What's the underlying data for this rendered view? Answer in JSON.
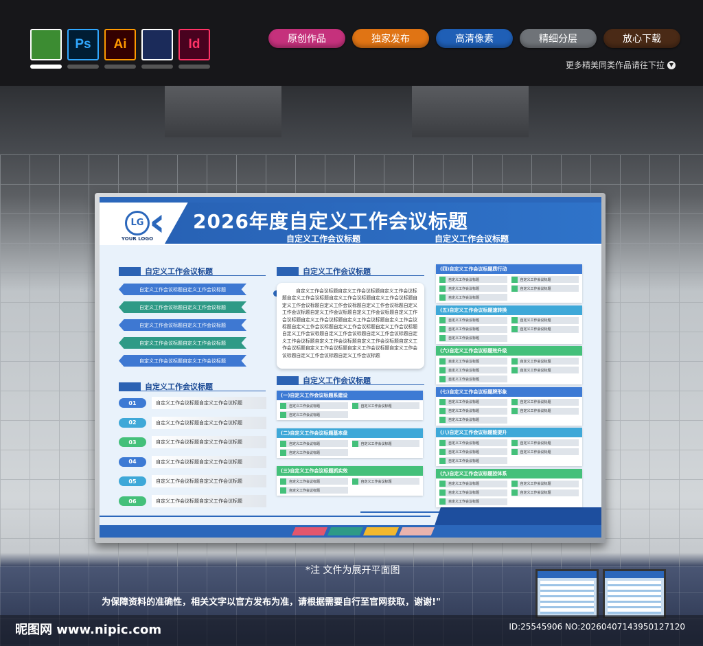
{
  "topbar": {
    "apps": [
      {
        "name": "coreldraw-icon",
        "label": "",
        "bg": "#3c8c32",
        "fg": "#fff"
      },
      {
        "name": "photoshop-icon",
        "label": "Ps",
        "bg": "#001d34",
        "fg": "#31a8ff"
      },
      {
        "name": "illustrator-icon",
        "label": "Ai",
        "bg": "#330000",
        "fg": "#ff9a00"
      },
      {
        "name": "cinema4d-icon",
        "label": "",
        "bg": "#1b2b5a",
        "fg": "#fff"
      },
      {
        "name": "indesign-icon",
        "label": "Id",
        "bg": "#49021f",
        "fg": "#ff3366"
      }
    ],
    "pills": [
      {
        "label": "原创作品",
        "color": "#c5317c"
      },
      {
        "label": "独家发布",
        "color": "#e07414"
      },
      {
        "label": "高清像素",
        "color": "#1f5fb6"
      },
      {
        "label": "精细分层",
        "color": "#6f7378"
      },
      {
        "label": "放心下载",
        "color": "#4a2a16"
      }
    ],
    "more_link": "更多精美同类作品请往下拉"
  },
  "board": {
    "logo_mark": "LG",
    "logo_text": "YOUR LOGO",
    "title": "2026年度自定义工作会议标题",
    "subtitles": [
      "自定义工作会议标题",
      "自定义工作会议标题"
    ],
    "left_sections": [
      {
        "title": "自定义工作会议标题"
      },
      {
        "title": "自定义工作会议标题"
      }
    ],
    "ribbons": [
      {
        "text": "自定义工作会议标题自定义工作会议标题",
        "color": "#3e78d2"
      },
      {
        "text": "自定义工作会议标题自定义工作会议标题",
        "color": "#2e9a86"
      },
      {
        "text": "自定义工作会议标题自定义工作会议标题",
        "color": "#3e78d2"
      },
      {
        "text": "自定义工作会议标题自定义工作会议标题",
        "color": "#2e9a86"
      },
      {
        "text": "自定义工作会议标题自定义工作会议标题",
        "color": "#3e78d2"
      }
    ],
    "numbered": [
      {
        "num": "01",
        "text": "自定义工作会议标题自定义工作会议标题",
        "color": "#3d7ad4"
      },
      {
        "num": "02",
        "text": "自定义工作会议标题自定义工作会议标题",
        "color": "#3ea8d8"
      },
      {
        "num": "03",
        "text": "自定义工作会议标题自定义工作会议标题",
        "color": "#44c07a"
      },
      {
        "num": "04",
        "text": "自定义工作会议标题自定义工作会议标题",
        "color": "#3d7ad4"
      },
      {
        "num": "05",
        "text": "自定义工作会议标题自定义工作会议标题",
        "color": "#3ea8d8"
      },
      {
        "num": "06",
        "text": "自定义工作会议标题自定义工作会议标题",
        "color": "#44c07a"
      }
    ],
    "mid_sections": [
      {
        "title": "自定义工作会议标题"
      },
      {
        "title": "自定义工作会议标题"
      }
    ],
    "paragraph": "自定义工作会议标题自定义工作会议标题自定义工作会议标题自定义工作会议标题自定义工作会议标题自定义工作会议标题自定义工作会议标题自定义工作会议标题自定义工作会议标题自定义工作会议标题自定义工作会议标题自定义工作会议标题自定义工作会议标题自定义工作会议标题自定义工作会议标题自定义工作会议标题自定义工作会议标题自定义工作会议标题自定义工作会议标题自定义工作会议标题自定义工作会议标题自定义工作会议标题自定义工作会议标题自定义工作会议标题自定义工作会议标题自定义工作会议标题自定义工作会议标题自定义工作会议标题自定义工作会议标题自定义工作会议标题自定义工作会议标题",
    "cell_text": "自定义工作会议标题",
    "mid_cards": [
      {
        "title": "(一)自定义工作会议标题系建设",
        "color": "#3d7ad4"
      },
      {
        "title": "(二)自定义工作会议标题基本盘",
        "color": "#3ea8d8"
      },
      {
        "title": "(三)自定义工作会议标题抓实效",
        "color": "#44c07a"
      }
    ],
    "right_cards": [
      {
        "title": "(四)自定义工作会议标题质行动",
        "color": "#3d7ad4"
      },
      {
        "title": "(五)自定义工作会议标题速转换",
        "color": "#3ea8d8"
      },
      {
        "title": "(六)自定义工作会议标题效升级",
        "color": "#44c07a"
      },
      {
        "title": "(七)自定义工作会议标题牌形象",
        "color": "#3d7ad4"
      },
      {
        "title": "(八)自定义工作会议标题能提升",
        "color": "#3ea8d8"
      },
      {
        "title": "(九)自定义工作会议标题控体系",
        "color": "#44c07a"
      }
    ],
    "footer_tabs": [
      "#e2566d",
      "#2e9a86",
      "#f2b82e",
      "#e9b3ad"
    ]
  },
  "note": "*注  文件为展开平面图",
  "disclaimer": "为保障资料的准确性，相关文字以官方发布为准，请根据需要自行至官网获取，谢谢!\"",
  "site": "昵图网 www.nipic.com",
  "id_text": "ID:25545906 NO:20260407143950127120"
}
